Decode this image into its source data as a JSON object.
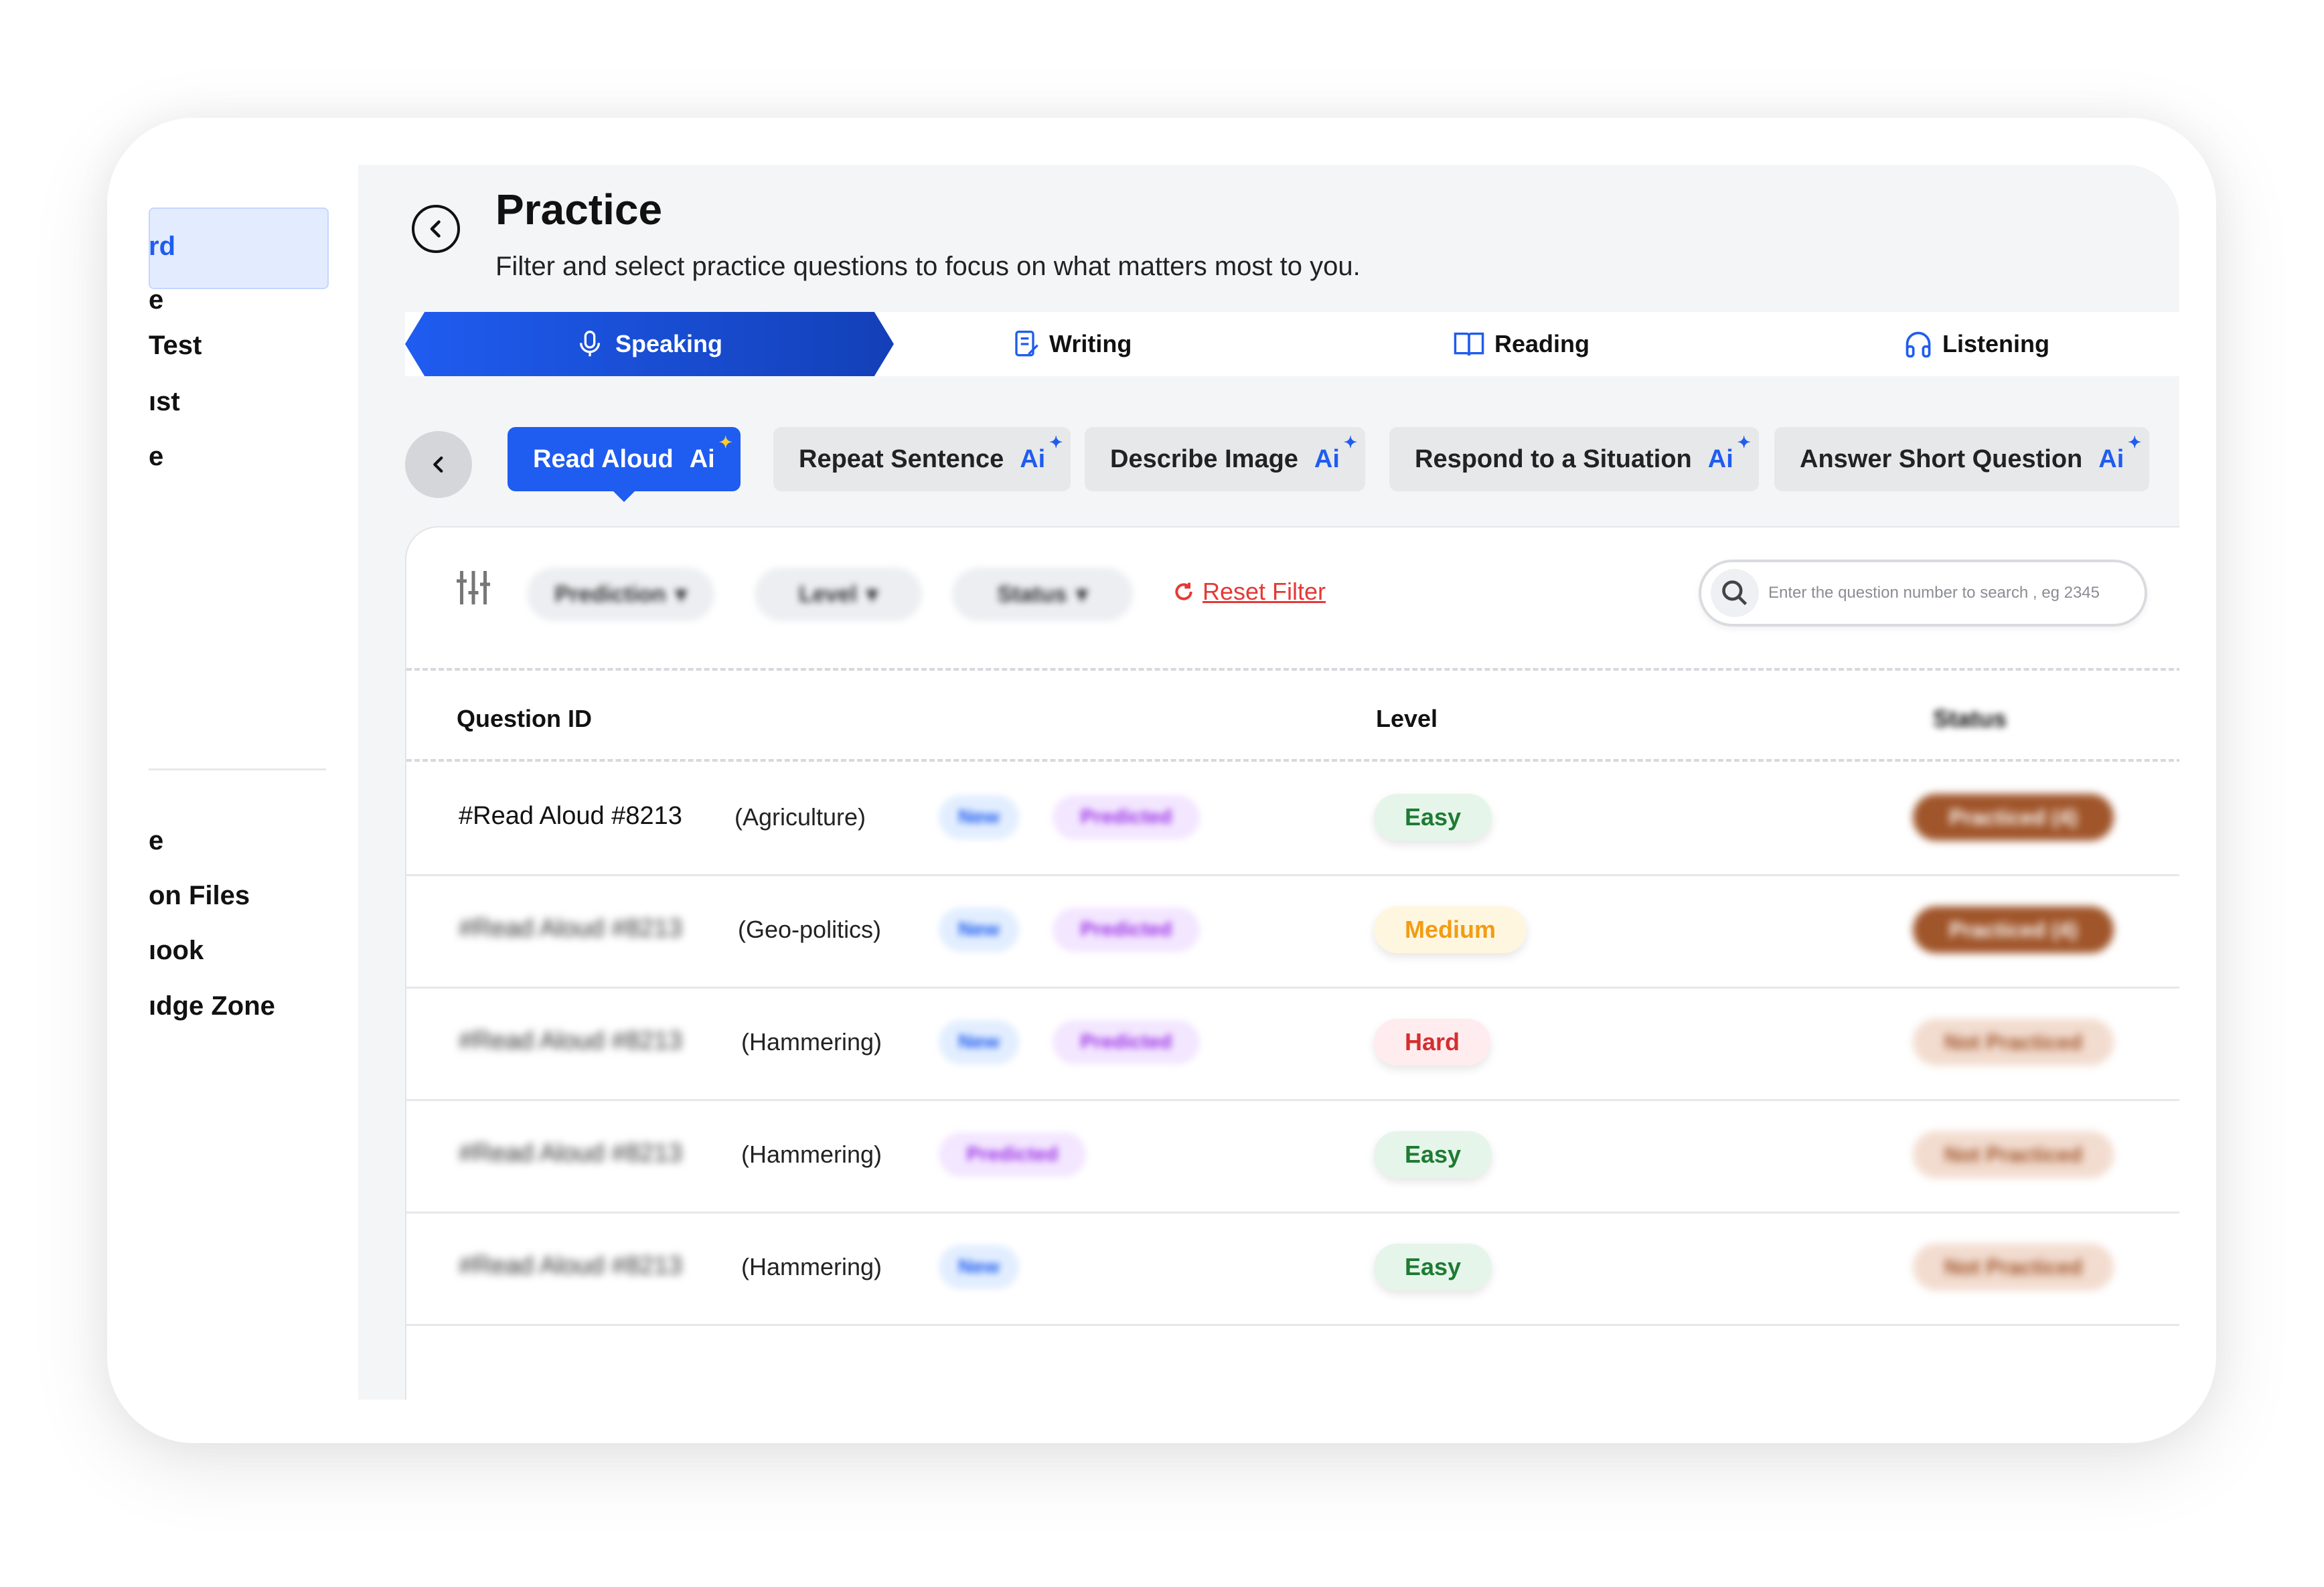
{
  "sidebar": {
    "items": [
      {
        "label": "rd",
        "active": true
      },
      {
        "label": "e"
      },
      {
        "label": "Test"
      },
      {
        "label": "ıst"
      },
      {
        "label": "e"
      },
      {
        "label": "e"
      },
      {
        "label": "on Files"
      },
      {
        "label": "ıook"
      },
      {
        "label": "ıdge Zone"
      }
    ]
  },
  "header": {
    "title": "Practice",
    "subtitle": "Filter and select practice questions to focus on what matters most to you."
  },
  "tabs": [
    {
      "label": "Speaking",
      "icon": "microphone-icon",
      "active": true
    },
    {
      "label": "Writing",
      "icon": "document-edit-icon"
    },
    {
      "label": "Reading",
      "icon": "book-open-icon"
    },
    {
      "label": "Listening",
      "icon": "headphones-icon"
    }
  ],
  "chips": [
    {
      "label": "Read Aloud",
      "badge": "Ai",
      "active": true
    },
    {
      "label": "Repeat Sentence",
      "badge": "Ai"
    },
    {
      "label": "Describe Image",
      "badge": "Ai"
    },
    {
      "label": "Respond to a Situation",
      "badge": "Ai"
    },
    {
      "label": "Answer Short Question",
      "badge": "Ai"
    }
  ],
  "filters": {
    "prediction": "Prediction",
    "level": "Level",
    "status": "Status",
    "reset": "Reset Filter",
    "search_placeholder": "Enter the question number to search , eg 2345"
  },
  "table": {
    "headers": {
      "question_id": "Question ID",
      "level": "Level",
      "status": "Status"
    },
    "rows": [
      {
        "id": "#Read Aloud #8213",
        "topic": "(Agriculture)",
        "new": "New",
        "predicted": "Predicted",
        "level": "Easy",
        "level_type": "easy",
        "status": "Practiced (4)",
        "status_type": "done"
      },
      {
        "id": "#Read Aloud #8213",
        "topic": "(Geo-politics)",
        "new": "New",
        "predicted": "Predicted",
        "level": "Medium",
        "level_type": "medium",
        "status": "Practiced (4)",
        "status_type": "done"
      },
      {
        "id": "#Read Aloud #8213",
        "topic": "(Hammering)",
        "new": "New",
        "predicted": "Predicted",
        "level": "Hard",
        "level_type": "hard",
        "status": "Not Practiced",
        "status_type": "not"
      },
      {
        "id": "#Read Aloud #8213",
        "topic": "(Hammering)",
        "new": "",
        "predicted": "Predicted",
        "level": "Easy",
        "level_type": "easy",
        "status": "Not Practiced",
        "status_type": "not"
      },
      {
        "id": "#Read Aloud #8213",
        "topic": "(Hammering)",
        "new": "New",
        "predicted": "",
        "level": "Easy",
        "level_type": "easy",
        "status": "Not Practiced",
        "status_type": "not"
      }
    ]
  },
  "colors": {
    "accent": "#1f5cf0",
    "reset": "#e53935"
  }
}
